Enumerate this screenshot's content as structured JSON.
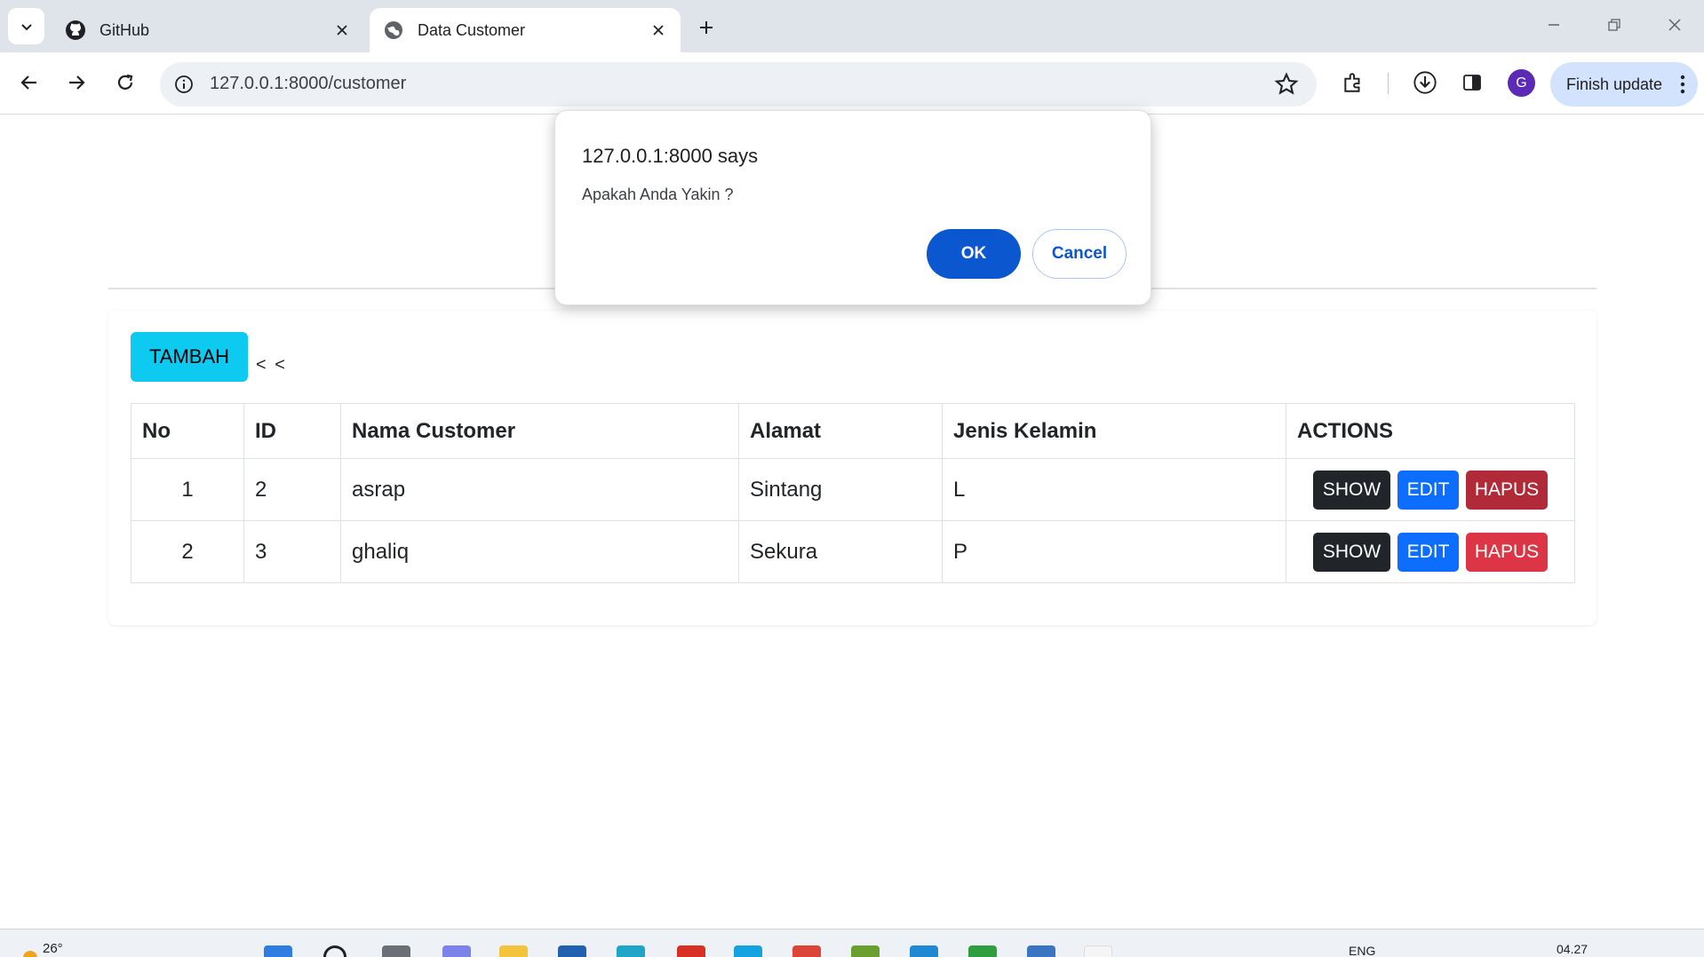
{
  "browser": {
    "tabs": [
      {
        "title": "GitHub",
        "icon": "github-icon",
        "active": false
      },
      {
        "title": "Data Customer",
        "icon": "globe-icon",
        "active": true
      }
    ],
    "url": "127.0.0.1:8000/customer",
    "avatar_letter": "G",
    "finish_update_label": "Finish update"
  },
  "dialog": {
    "title": "127.0.0.1:8000 says",
    "message": "Apakah Anda Yakin ?",
    "ok_label": "OK",
    "cancel_label": "Cancel"
  },
  "page": {
    "add_button": "TAMBAH",
    "back_link": "< <",
    "table": {
      "headers": [
        "No",
        "ID",
        "Nama Customer",
        "Alamat",
        "Jenis Kelamin",
        "ACTIONS"
      ],
      "rows": [
        {
          "no": "1",
          "id": "2",
          "nama": "asrap",
          "alamat": "Sintang",
          "jk": "L"
        },
        {
          "no": "2",
          "id": "3",
          "nama": "ghaliq",
          "alamat": "Sekura",
          "jk": "P"
        }
      ],
      "actions": {
        "show": "SHOW",
        "edit": "EDIT",
        "hapus": "HAPUS"
      }
    }
  },
  "taskbar": {
    "temperature": "26°",
    "language": "ENG",
    "time": "04.27"
  },
  "colors": {
    "tambah": "#0dcaf0",
    "show": "#212529",
    "edit": "#0d6efd",
    "hapus": "#dc3545",
    "dialog_primary": "#0b57d0"
  }
}
